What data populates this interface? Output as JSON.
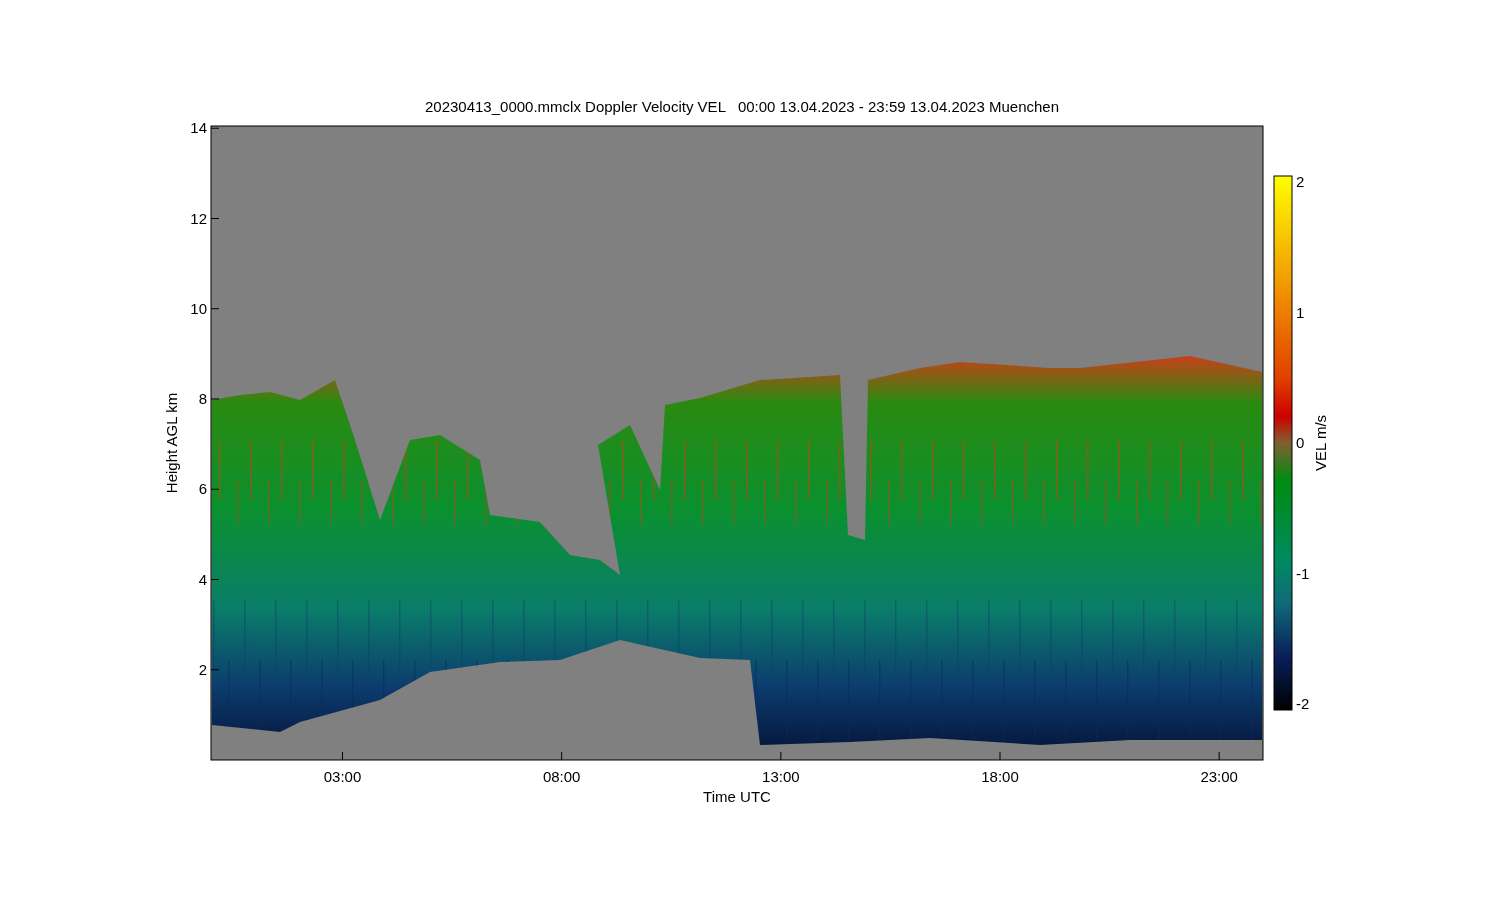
{
  "title": "20230413_0000.mmclx Doppler Velocity VEL   00:00 13.04.2023 - 23:59 13.04.2023 Muenchen",
  "plot": {
    "y_axis": {
      "label": "Height AGL km",
      "ticks": [
        "14",
        "12",
        "10",
        "8",
        "6",
        "4",
        "2"
      ]
    },
    "x_axis": {
      "label": "Time UTC",
      "ticks": [
        "03:00",
        "08:00",
        "13:00",
        "18:00",
        "23:00"
      ]
    }
  },
  "colorbar": {
    "label": "VEL m/s",
    "ticks": [
      "2",
      "1",
      "0",
      "-1",
      "-2"
    ]
  }
}
